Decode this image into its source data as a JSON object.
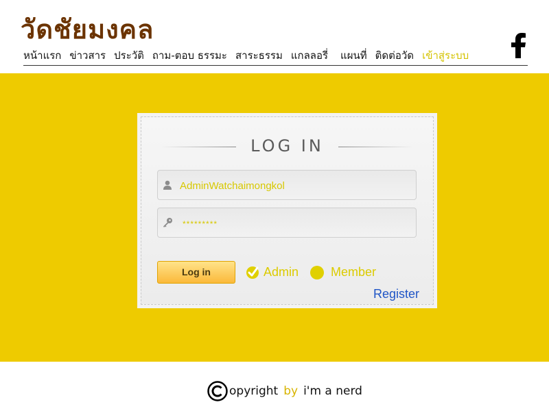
{
  "header": {
    "site_title": "วัดชัยมงคล",
    "nav": [
      {
        "label": "หน้าแรก"
      },
      {
        "label": "ข่าวสาร"
      },
      {
        "label": "ประวัติ"
      },
      {
        "label": "ถาม-ตอบ ธรรมะ"
      },
      {
        "label": "สาระธรรม"
      },
      {
        "label": "แกลลอรี่"
      },
      {
        "label": "แผนที่"
      },
      {
        "label": "ติดต่อวัด"
      },
      {
        "label": "เข้าสู่ระบบ",
        "active": true
      }
    ],
    "social_icon": "facebook-icon"
  },
  "login": {
    "title": "LOG IN",
    "username_value": "AdminWatchaimongkol",
    "password_value": "*********",
    "login_button": "Log in",
    "role_admin": "Admin",
    "role_member": "Member",
    "selected_role": "Admin",
    "register_link": "Register"
  },
  "footer": {
    "copyright_word": "opyright",
    "by": "by",
    "author": "i'm a nerd"
  },
  "colors": {
    "band": "#eecb00",
    "title": "#6b3300",
    "accent_text": "#dccb00",
    "link": "#1f55c6"
  }
}
